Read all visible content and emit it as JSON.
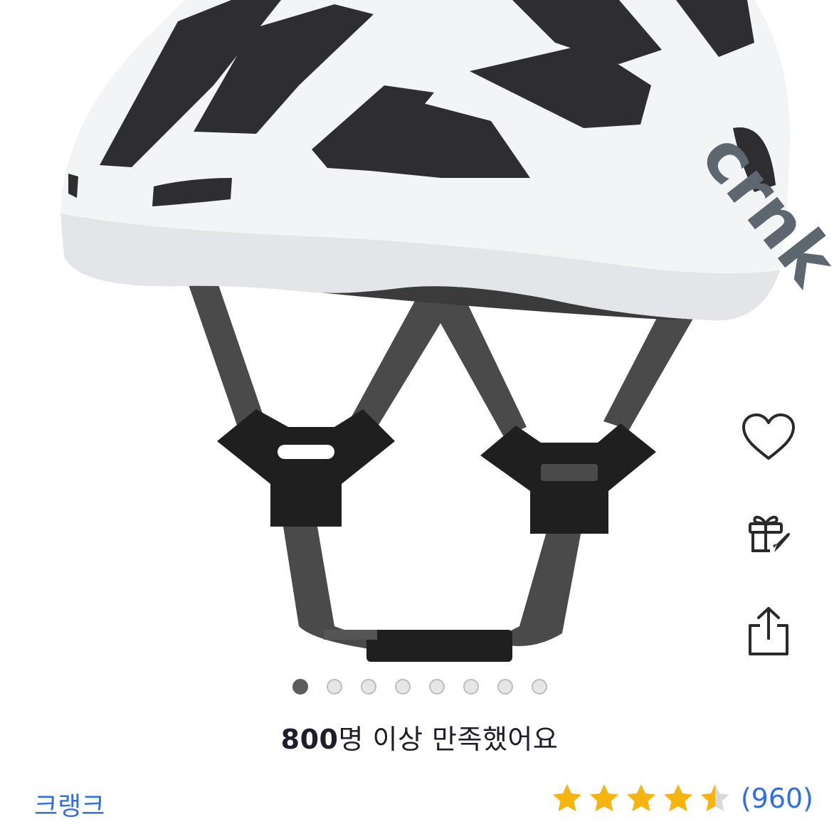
{
  "product": {
    "image_alt": "crnk cycling helmet",
    "logo_text": "crnk"
  },
  "actions": {
    "wishlist_icon": "heart-icon",
    "gift_icon": "gift-rocket-icon",
    "share_icon": "share-icon"
  },
  "carousel": {
    "total": 8,
    "active_index": 0
  },
  "satisfaction": {
    "count": "800",
    "text": "명 이상 만족했어요"
  },
  "brand": {
    "name": "크랭크"
  },
  "rating": {
    "value": 4.5,
    "max": 5,
    "count_label": "(960)"
  },
  "colors": {
    "brand_link": "#2f6fe6",
    "star_fill": "#f6b40e",
    "star_empty": "#d9d9d9",
    "dot_active": "#5c5c5c",
    "dot_inactive": "#e6e6e6"
  }
}
